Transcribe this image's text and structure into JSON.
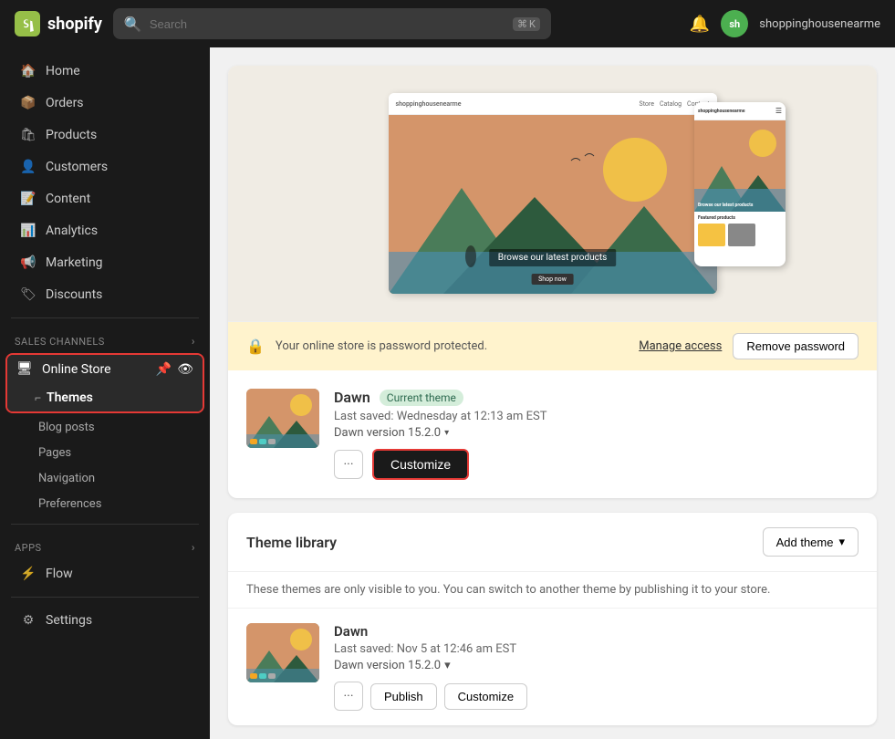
{
  "topbar": {
    "logo_text": "shopify",
    "search_placeholder": "Search",
    "kbd_modifier": "⌘",
    "kbd_key": "K",
    "store_name": "shoppinghousenearme",
    "avatar_initials": "sh"
  },
  "sidebar": {
    "nav_items": [
      {
        "id": "home",
        "label": "Home",
        "icon": "home"
      },
      {
        "id": "orders",
        "label": "Orders",
        "icon": "orders"
      },
      {
        "id": "products",
        "label": "Products",
        "icon": "products"
      },
      {
        "id": "customers",
        "label": "Customers",
        "icon": "customers"
      },
      {
        "id": "content",
        "label": "Content",
        "icon": "content"
      },
      {
        "id": "analytics",
        "label": "Analytics",
        "icon": "analytics"
      },
      {
        "id": "marketing",
        "label": "Marketing",
        "icon": "marketing"
      },
      {
        "id": "discounts",
        "label": "Discounts",
        "icon": "discounts"
      }
    ],
    "sales_channels_label": "Sales channels",
    "online_store_label": "Online Store",
    "themes_label": "Themes",
    "sub_items": [
      "Blog posts",
      "Pages",
      "Navigation",
      "Preferences"
    ],
    "apps_label": "Apps",
    "apps_items": [
      "Flow"
    ],
    "settings_label": "Settings"
  },
  "theme_preview": {
    "store_preview_text": "Browse our latest products",
    "desktop_brand": "shoppinghousenearme",
    "desktop_nav": [
      "Store",
      "Catalog",
      "Contact"
    ],
    "mobile_brand": "shoppinghousenearme",
    "mobile_hero_text": "Browse our latest products",
    "mobile_featured_label": "Featured products"
  },
  "password_banner": {
    "message": "Your online store is password protected.",
    "manage_access_label": "Manage access",
    "remove_password_label": "Remove password"
  },
  "current_theme": {
    "name": "Dawn",
    "badge": "Current theme",
    "last_saved": "Last saved: Wednesday at 12:13 am EST",
    "version": "Dawn version 15.2.0",
    "customize_label": "Customize",
    "more_icon": "···"
  },
  "theme_library": {
    "title": "Theme library",
    "add_theme_label": "Add theme",
    "description": "These themes are only visible to you. You can switch to another theme by publishing it to your store.",
    "items": [
      {
        "name": "Dawn",
        "last_saved": "Last saved: Nov 5 at 12:46 am EST",
        "version": "Dawn version 15.2.0",
        "publish_label": "Publish",
        "customize_label": "Customize"
      }
    ]
  }
}
